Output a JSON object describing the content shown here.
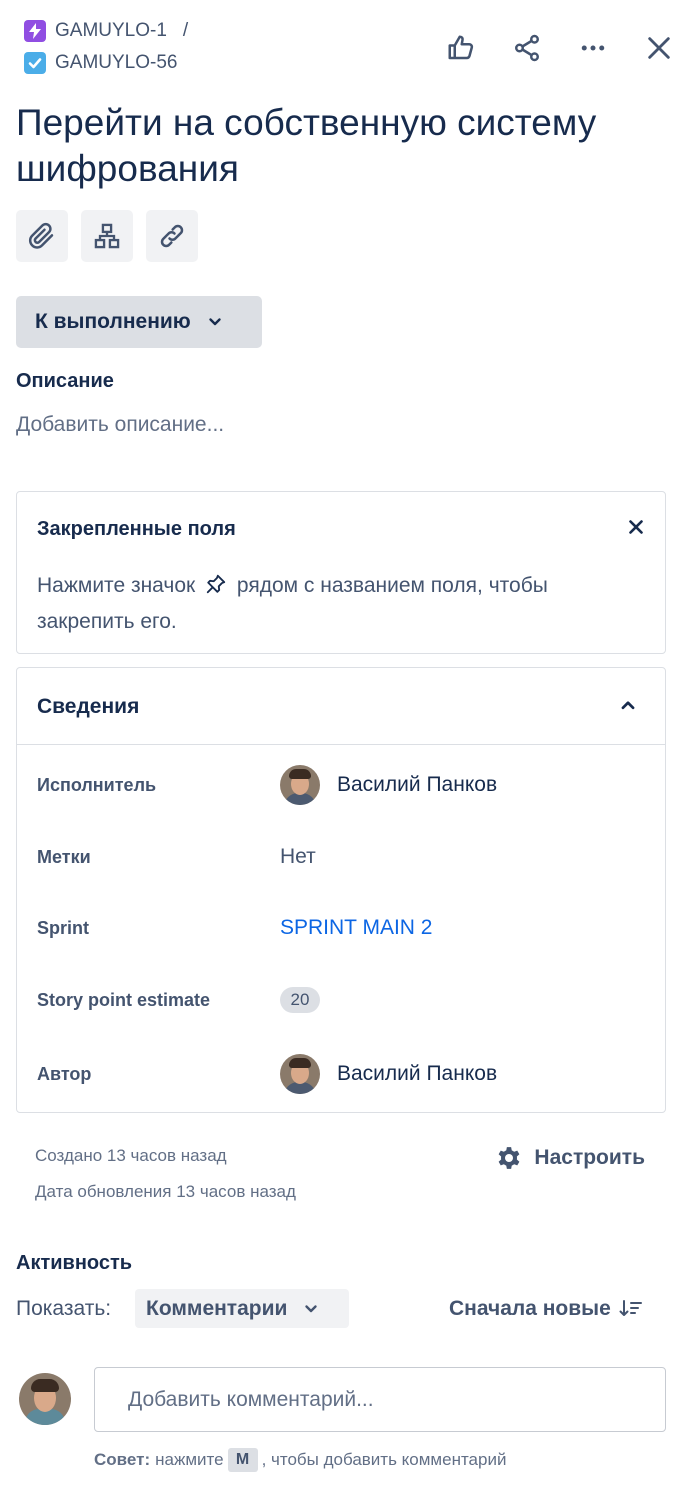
{
  "breadcrumbs": {
    "parent_key": "GAMUYLO-1",
    "separator": "/",
    "issue_key": "GAMUYLO-56"
  },
  "issue": {
    "title": "Перейти на собственную систему шифрования",
    "status_label": "К выполнению"
  },
  "description": {
    "heading": "Описание",
    "placeholder": "Добавить описание..."
  },
  "pinned": {
    "heading": "Закрепленные поля",
    "hint_before": "Нажмите значок",
    "hint_after": "рядом с названием поля, чтобы закрепить его."
  },
  "details": {
    "heading": "Сведения",
    "assignee_label": "Исполнитель",
    "assignee_value": "Василий Панков",
    "labels_label": "Метки",
    "labels_value": "Нет",
    "sprint_label": "Sprint",
    "sprint_value": "SPRINT MAIN 2",
    "story_points_label": "Story point estimate",
    "story_points_value": "20",
    "reporter_label": "Автор",
    "reporter_value": "Василий Панков"
  },
  "meta": {
    "created": "Создано 13 часов назад",
    "updated": "Дата обновления 13 часов назад",
    "configure_label": "Настроить"
  },
  "activity": {
    "heading": "Активность",
    "show_label": "Показать:",
    "filter_value": "Комментарии",
    "sort_label": "Сначала новые",
    "comment_placeholder": "Добавить комментарий...",
    "tip_bold": "Совет:",
    "tip_before": "нажмите",
    "tip_key": "M",
    "tip_after": ", чтобы добавить комментарий"
  },
  "colors": {
    "epic_badge": "#904ee2",
    "task_badge": "#4bade8",
    "link": "#0c66e4",
    "status_bg": "#dcdfe4"
  },
  "icons": [
    "lightning-icon",
    "checkbox-icon",
    "thumbs-up-icon",
    "share-icon",
    "more-icon",
    "close-icon",
    "paperclip-icon",
    "hierarchy-icon",
    "link-icon",
    "chevron-down-icon",
    "pin-icon",
    "chevron-up-icon",
    "gear-icon",
    "sort-icon"
  ]
}
